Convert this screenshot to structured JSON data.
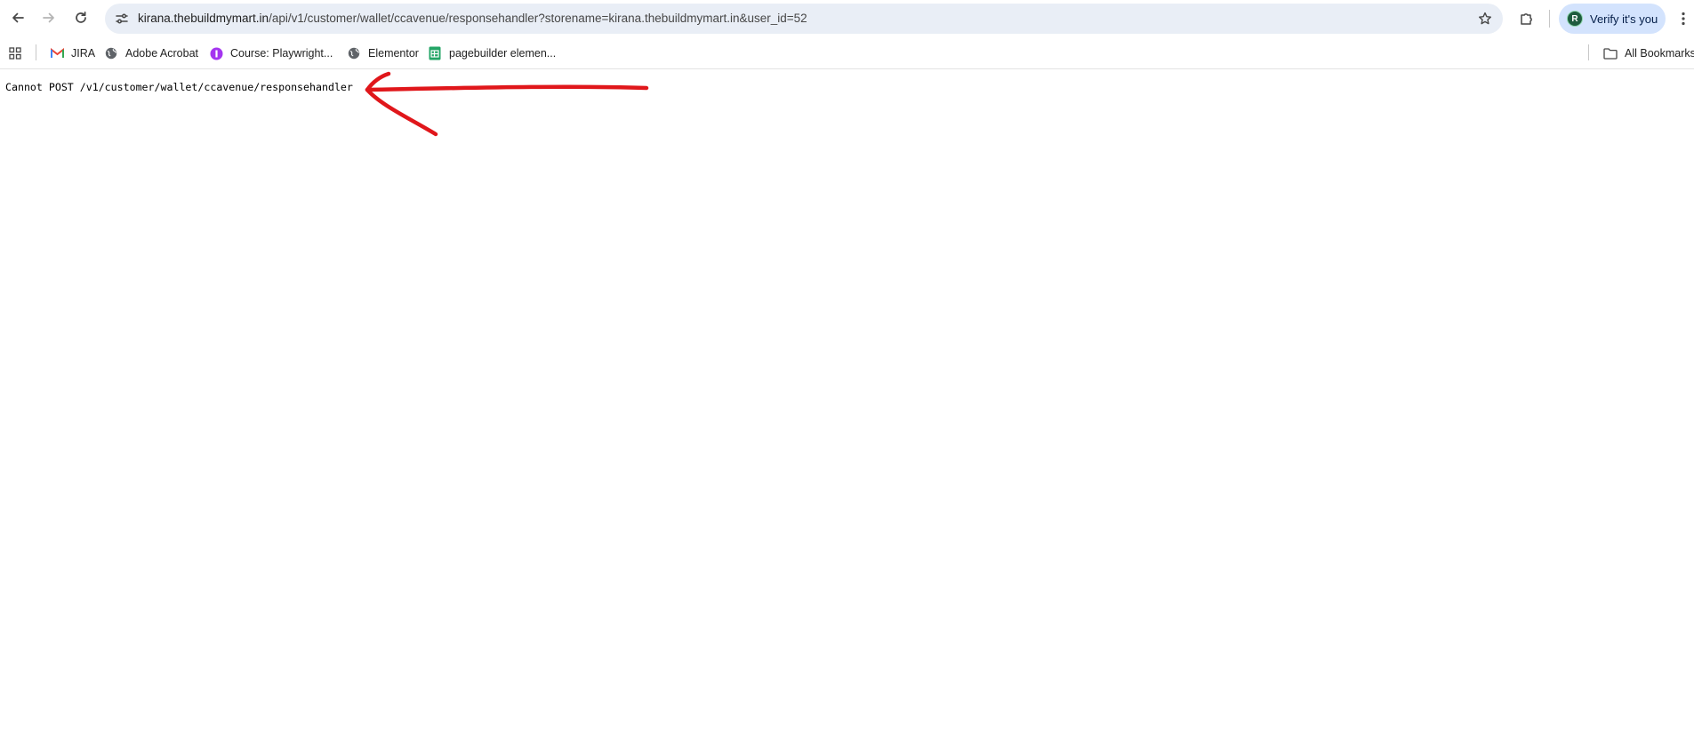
{
  "browser": {
    "url_host": "kirana.thebuildmymart.in",
    "url_path": "/api/v1/customer/wallet/ccavenue/responsehandler?storename=kirana.thebuildmymart.in&user_id=52",
    "profile_initial": "R",
    "profile_label": "Verify it's you"
  },
  "bookmarks": {
    "items": [
      {
        "label": "JIRA",
        "icon": "gmail-icon"
      },
      {
        "label": "Adobe Acrobat",
        "icon": "globe-icon"
      },
      {
        "label": "Course: Playwright...",
        "icon": "course-icon"
      },
      {
        "label": "Elementor",
        "icon": "globe-icon"
      },
      {
        "label": "pagebuilder elemen...",
        "icon": "sheets-icon"
      }
    ],
    "all_bookmarks": "All Bookmarks"
  },
  "page": {
    "error_message": "Cannot POST /v1/customer/wallet/ccavenue/responsehandler"
  },
  "colors": {
    "annotation_arrow": "#e0171b",
    "omnibox_bg": "#e9eef6",
    "profile_bg": "#d3e3fd"
  }
}
